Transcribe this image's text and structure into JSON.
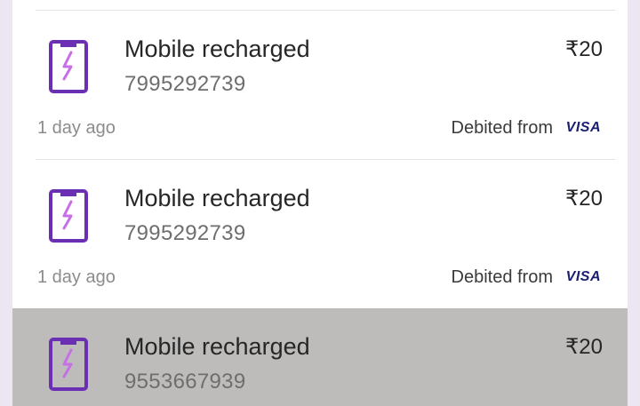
{
  "transactions": [
    {
      "title": "Mobile recharged",
      "number": "7995292739",
      "amount": "₹20",
      "time": "1 day ago",
      "debited_label": "Debited from",
      "card": "VISA"
    },
    {
      "title": "Mobile recharged",
      "number": "7995292739",
      "amount": "₹20",
      "time": "1 day ago",
      "debited_label": "Debited from",
      "card": "VISA"
    },
    {
      "title": "Mobile recharged",
      "number": "9553667939",
      "amount": "₹20"
    }
  ],
  "icons": {
    "recharge": "mobile-recharge-icon"
  },
  "colors": {
    "accent": "#6b2fb3",
    "bolt": "#c86ee6",
    "pressed_row": "#bdbcbb",
    "visa": "#1a1f71"
  }
}
